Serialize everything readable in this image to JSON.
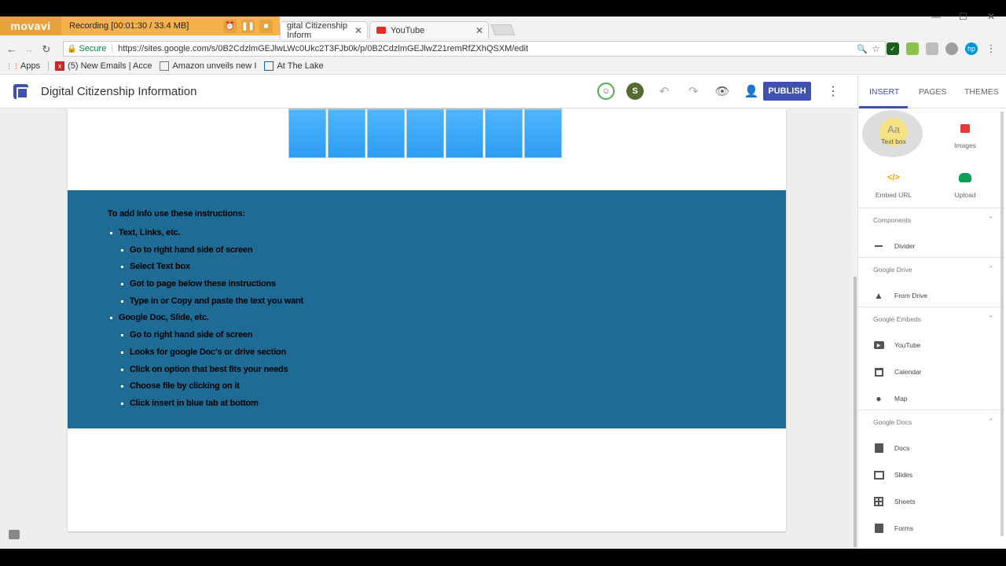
{
  "recorder": {
    "logo": "movavi",
    "status": "Recording  [00:01:30 / 33.4 MB]",
    "buttons": [
      "alarm-clock",
      "pause",
      "stop"
    ]
  },
  "tabs": [
    {
      "label": "gital Citizenship Inform",
      "active": true
    },
    {
      "label": "YouTube",
      "active": false
    }
  ],
  "address": {
    "secure_label": "Secure",
    "url": "https://sites.google.com/s/0B2CdzlmGEJlwLWc0Ukc2T3FJb0k/p/0B2CdzlmGEJlwZ21remRfZXhQSXM/edit"
  },
  "bookmarks": [
    {
      "label": "Apps",
      "icon": "apps-grid-icon"
    },
    {
      "label": "(5) New Emails | Acce",
      "icon": "xf-icon"
    },
    {
      "label": "Amazon unveils new I",
      "icon": "page-icon"
    },
    {
      "label": "At The Lake",
      "icon": "table-icon"
    }
  ],
  "header": {
    "title": "Digital Citizenship Information",
    "avatar_initial": "S",
    "publish_label": "PUBLISH"
  },
  "panel": {
    "tabs": [
      "INSERT",
      "PAGES",
      "THEMES"
    ],
    "big_buttons": [
      {
        "label": "Text box",
        "icon": "Aa"
      },
      {
        "label": "Images",
        "icon": "image-icon"
      },
      {
        "label": "Embed URL",
        "icon": "</>"
      },
      {
        "label": "Upload",
        "icon": "cloud-upload-icon"
      }
    ],
    "sections": [
      {
        "title": "Components",
        "items": [
          {
            "label": "Divider"
          }
        ]
      },
      {
        "title": "Google Drive",
        "items": [
          {
            "label": "From Drive"
          }
        ]
      },
      {
        "title": "Google Embeds",
        "items": [
          {
            "label": "YouTube"
          },
          {
            "label": "Calendar"
          },
          {
            "label": "Map"
          }
        ]
      },
      {
        "title": "Google Docs",
        "items": [
          {
            "label": "Docs"
          },
          {
            "label": "Slides"
          },
          {
            "label": "Sheets"
          },
          {
            "label": "Forms"
          }
        ]
      }
    ]
  },
  "instructions": {
    "heading": "To add Info use these instructions:",
    "groups": [
      {
        "label": "Text, Links, etc.",
        "steps": [
          "Go to right hand side of screen",
          "Select Text box",
          "Got to page below these instructions",
          "Type in or Copy and paste the text you want"
        ]
      },
      {
        "label": "Google Doc, Slide, etc.",
        "steps": [
          "Go to right hand side of screen",
          "Looks for google Doc's or drive section",
          "Click on option that best fits your needs",
          "Choose file by clicking on it",
          "Click insert in blue tab at bottom"
        ]
      }
    ]
  }
}
